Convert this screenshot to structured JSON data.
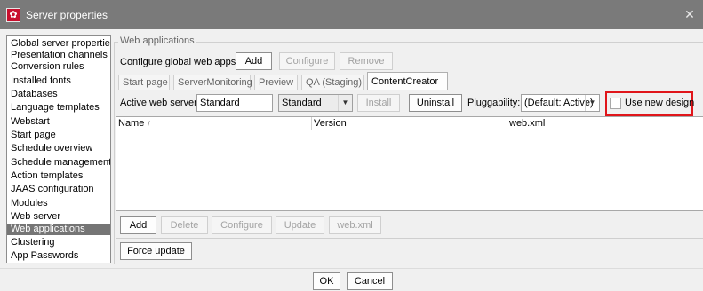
{
  "window": {
    "title": "Server properties",
    "close_glyph": "✕"
  },
  "icons": {
    "app": "gear-icon",
    "close": "close-icon",
    "dropdown": "chevron-down-icon",
    "sort": "sort-arrow-icon"
  },
  "colors": {
    "titlebar": "#7a7a7a",
    "selected_nav": "#757575",
    "highlight": "#e0151a",
    "app_icon": "#c8102e"
  },
  "nav": {
    "items": [
      {
        "label": "Global server properties",
        "selected": false
      },
      {
        "label": "Presentation channels",
        "selected": false
      },
      {
        "label": "Conversion rules",
        "selected": false
      },
      {
        "label": "Installed fonts",
        "selected": false
      },
      {
        "label": "Databases",
        "selected": false
      },
      {
        "label": "Language templates",
        "selected": false
      },
      {
        "label": "Webstart",
        "selected": false
      },
      {
        "label": "Start page",
        "selected": false
      },
      {
        "label": "Schedule overview",
        "selected": false
      },
      {
        "label": "Schedule management",
        "selected": false
      },
      {
        "label": "Action templates",
        "selected": false
      },
      {
        "label": "JAAS configuration",
        "selected": false
      },
      {
        "label": "Modules",
        "selected": false
      },
      {
        "label": "Web server",
        "selected": false
      },
      {
        "label": "Web applications",
        "selected": true
      },
      {
        "label": "Clustering",
        "selected": false
      },
      {
        "label": "App Passwords",
        "selected": false
      }
    ]
  },
  "panel": {
    "group_title": "Web applications",
    "global_label": "Configure global web apps:",
    "global_buttons": {
      "add": "Add",
      "configure": "Configure",
      "remove": "Remove"
    },
    "tabs": [
      "Start page",
      "ServerMonitoring",
      "Preview",
      "QA (Staging)",
      "ContentCreator"
    ],
    "active_tab": "ContentCreator",
    "active_server_label": "Active web server:",
    "active_server_value": "Standard",
    "server_combo_value": "Standard",
    "install_label": "Install",
    "uninstall_label": "Uninstall",
    "pluggability_label": "Pluggability:",
    "pluggability_value": "(Default: Active)",
    "use_new_design_label": "Use new design",
    "use_new_design_checked": false,
    "table": {
      "columns": [
        {
          "label": "Name",
          "sort": "/"
        },
        {
          "label": "Version"
        },
        {
          "label": "web.xml"
        }
      ],
      "rows": []
    },
    "row_buttons": {
      "add": "Add",
      "delete": "Delete",
      "configure": "Configure",
      "update": "Update",
      "webxml": "web.xml"
    },
    "force_update": "Force update"
  },
  "footer": {
    "ok": "OK",
    "cancel": "Cancel"
  }
}
